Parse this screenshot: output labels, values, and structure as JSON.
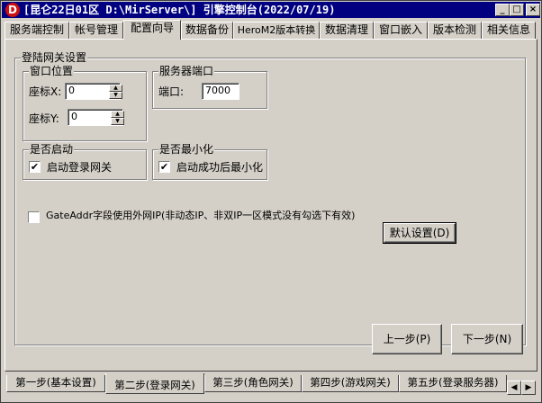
{
  "window": {
    "title": "[昆仑22日01区 D:\\MirServer\\] 引擎控制台(2022/07/19)",
    "icon_letter": "D"
  },
  "titlebar_buttons": {
    "minimize": "_",
    "maximize": "□",
    "close": "×"
  },
  "top_tabs": [
    "服务端控制",
    "帐号管理",
    "配置向导",
    "数据备份",
    "HeroM2版本转换",
    "数据清理",
    "窗口嵌入",
    "版本检测",
    "相关信息"
  ],
  "active_top_tab": "配置向导",
  "section": {
    "title": "登陆网关设置",
    "window_pos": {
      "title": "窗口位置",
      "x_label": "座标X:",
      "x_value": "0",
      "y_label": "座标Y:",
      "y_value": "0"
    },
    "server_port": {
      "title": "服务器端口",
      "port_label": "端口:",
      "port_value": "7000"
    },
    "enable": {
      "title": "是否启动",
      "checkbox_label": "启动登录网关",
      "checked": true
    },
    "minimize": {
      "title": "是否最小化",
      "checkbox_label": "启动成功后最小化",
      "checked": true
    },
    "gateaddr_label": "GateAddr字段使用外网IP(非动态IP、非双IP一区模式没有勾选下有效)",
    "gateaddr_checked": false,
    "default_button": "默认设置(D)"
  },
  "nav": {
    "prev": "上一步(P)",
    "next": "下一步(N)"
  },
  "bottom_tabs": [
    "第一步(基本设置)",
    "第二步(登录网关)",
    "第三步(角色网关)",
    "第四步(游戏网关)",
    "第五步(登录服务器)"
  ],
  "active_bottom_tab": "第二步(登录网关)",
  "check_glyph": "✔",
  "spin_up": "▲",
  "spin_down": "▼",
  "scroll_left": "◀",
  "scroll_right": "▶"
}
